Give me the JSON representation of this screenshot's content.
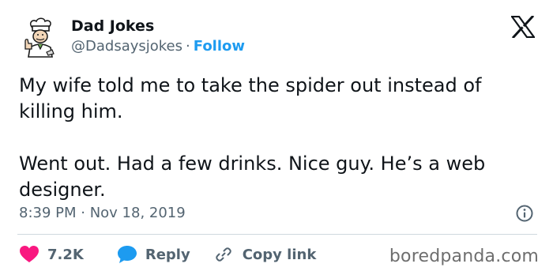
{
  "author": {
    "display_name": "Dad Jokes",
    "handle": "@Dadsaysjokes",
    "separator": "·",
    "follow_label": "Follow",
    "avatar_icon": "chef-avatar-icon"
  },
  "platform": {
    "logo_icon": "x-logo-icon"
  },
  "tweet": {
    "paragraphs": [
      "My wife told me to take the spider out instead of killing him.",
      "Went out. Had a few drinks. Nice guy. He’s a web designer."
    ],
    "timestamp": "8:39 PM · Nov 18, 2019",
    "info_icon": "info-icon"
  },
  "actions": {
    "like_count": "7.2K",
    "like_icon": "heart-icon",
    "reply_label": "Reply",
    "reply_icon": "speech-bubble-icon",
    "copy_link_label": "Copy link",
    "copy_link_icon": "link-icon"
  },
  "watermark": "boredpanda.com",
  "colors": {
    "text": "#0f1419",
    "secondary": "#536471",
    "accent": "#1d9bf0",
    "like": "#f91880",
    "divider": "#cfd9de",
    "watermark": "#6e6e6e"
  }
}
